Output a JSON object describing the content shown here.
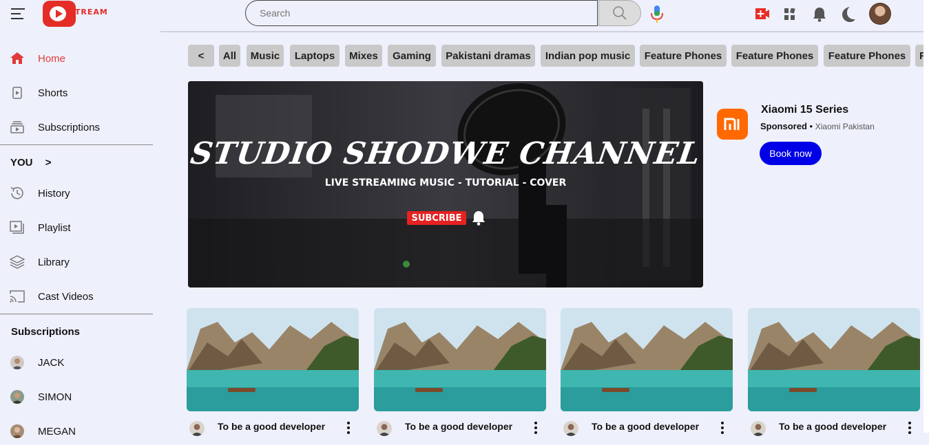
{
  "header": {
    "logo_text": "STREAM",
    "search_placeholder": "Search"
  },
  "sidebar": {
    "main": [
      {
        "label": "Home",
        "icon": "home-icon",
        "active": true
      },
      {
        "label": "Shorts",
        "icon": "shorts-icon"
      },
      {
        "label": "Subscriptions",
        "icon": "subscriptions-icon"
      }
    ],
    "you_heading": "YOU",
    "you_chevron": ">",
    "you_items": [
      {
        "label": "History",
        "icon": "history-icon"
      },
      {
        "label": "Playlist",
        "icon": "playlist-icon"
      },
      {
        "label": "Library",
        "icon": "library-icon"
      },
      {
        "label": "Cast Videos",
        "icon": "cast-icon"
      }
    ],
    "subscriptions_heading": "Subscriptions",
    "subscriptions": [
      {
        "label": "JACK"
      },
      {
        "label": "SIMON"
      },
      {
        "label": "MEGAN"
      }
    ]
  },
  "chips": [
    "<",
    "All",
    "Music",
    "Laptops",
    "Mixes",
    "Gaming",
    "Pakistani dramas",
    "Indian pop music",
    "Feature Phones",
    "Feature Phones",
    "Feature Phones",
    "F"
  ],
  "banner": {
    "title": "STUDIO SHODWE CHANNEL",
    "subtitle": "LIVE STREAMING MUSIC - TUTORIAL - COVER",
    "subscribe_label": "SUBCRIBE"
  },
  "ad": {
    "title": "Xiaomi 15 Series",
    "sponsored": "Sponsored",
    "separator": "•",
    "advertiser": "Xiaomi Pakistan",
    "cta": "Book now",
    "brand_color": "#ff6900"
  },
  "videos": [
    {
      "title": "To be a good developer"
    },
    {
      "title": "To be a good developer"
    },
    {
      "title": "To be a good developer"
    },
    {
      "title": "To be a good developer"
    }
  ],
  "colors": {
    "accent": "#e52d27",
    "active_nav": "#e03b3b",
    "cta_blue": "#0000e6",
    "background": "#eef0fb"
  }
}
